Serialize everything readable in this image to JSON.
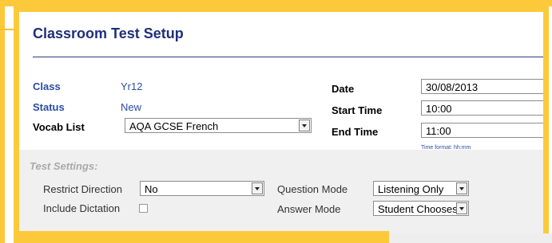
{
  "header": {
    "title": "Classroom Test Setup"
  },
  "info": {
    "class_label": "Class",
    "class_value": "Yr12",
    "status_label": "Status",
    "status_value": "New",
    "vocab_label": "Vocab List",
    "vocab_value": "AQA GCSE French"
  },
  "schedule": {
    "date_label": "Date",
    "date_value": "30/08/2013",
    "start_label": "Start Time",
    "start_value": "10:00",
    "end_label": "End Time",
    "end_value": "11:00",
    "time_hint": "Time format: hh:mm"
  },
  "settings": {
    "heading": "Test Settings:",
    "restrict_label": "Restrict Direction",
    "restrict_value": "No",
    "dictation_label": "Include Dictation",
    "dictation_checked": false,
    "question_label": "Question Mode",
    "question_value": "Listening Only",
    "answer_label": "Answer Mode",
    "answer_value": "Student Chooses"
  },
  "colors": {
    "highlight": "#fcc93b",
    "title": "#1f2f7a",
    "label": "#2b4ca0"
  }
}
